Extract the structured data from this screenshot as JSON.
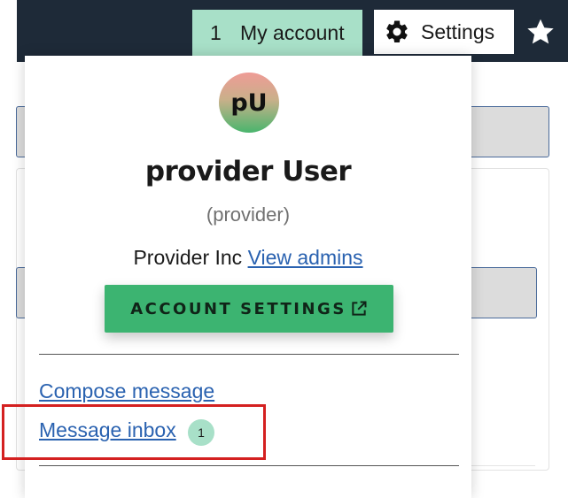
{
  "header": {
    "account_count": "1",
    "account_label": "My account",
    "settings_label": "Settings"
  },
  "user": {
    "initials": "pU",
    "name": "provider User",
    "role": "(provider)",
    "org": "Provider Inc",
    "view_admins_label": "View admins"
  },
  "account_settings_label": "ACCOUNT SETTINGS",
  "menu": {
    "compose_label": "Compose message",
    "inbox_label": "Message inbox",
    "inbox_count": "1"
  },
  "colors": {
    "topbar": "#1e2a38",
    "account_tab": "#a8e0c8",
    "primary_button": "#3cb471",
    "link": "#2a62b0",
    "highlight": "#d42020"
  },
  "icons": {
    "settings": "gear-icon",
    "favorite": "star-icon",
    "external": "external-link-icon"
  }
}
